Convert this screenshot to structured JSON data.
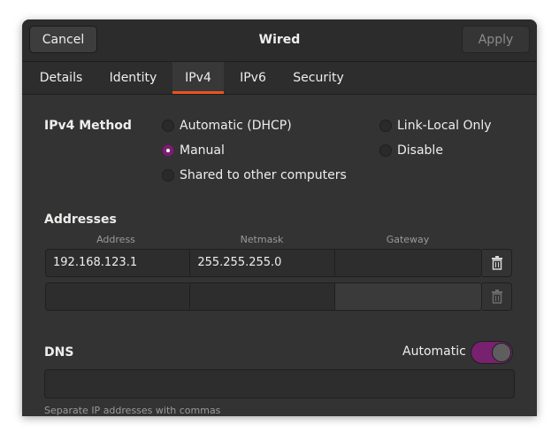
{
  "window": {
    "title": "Wired",
    "cancel_label": "Cancel",
    "apply_label": "Apply"
  },
  "tabs": [
    {
      "label": "Details",
      "active": false
    },
    {
      "label": "Identity",
      "active": false
    },
    {
      "label": "IPv4",
      "active": true
    },
    {
      "label": "IPv6",
      "active": false
    },
    {
      "label": "Security",
      "active": false
    }
  ],
  "ipv4_method": {
    "label": "IPv4 Method",
    "options": [
      {
        "label": "Automatic (DHCP)",
        "checked": false
      },
      {
        "label": "Link-Local Only",
        "checked": false
      },
      {
        "label": "Manual",
        "checked": true
      },
      {
        "label": "Disable",
        "checked": false
      },
      {
        "label": "Shared to other computers",
        "checked": false
      }
    ]
  },
  "addresses": {
    "label": "Addresses",
    "columns": [
      "Address",
      "Netmask",
      "Gateway"
    ],
    "rows": [
      {
        "address": "192.168.123.1",
        "netmask": "255.255.255.0",
        "gateway": ""
      },
      {
        "address": "",
        "netmask": "",
        "gateway": ""
      }
    ]
  },
  "dns": {
    "label": "DNS",
    "automatic_label": "Automatic",
    "automatic_on": true,
    "value": "",
    "hint": "Separate IP addresses with commas"
  },
  "colors": {
    "accent": "#77216f",
    "active_tab_underline": "#e95420",
    "background": "#333333"
  }
}
